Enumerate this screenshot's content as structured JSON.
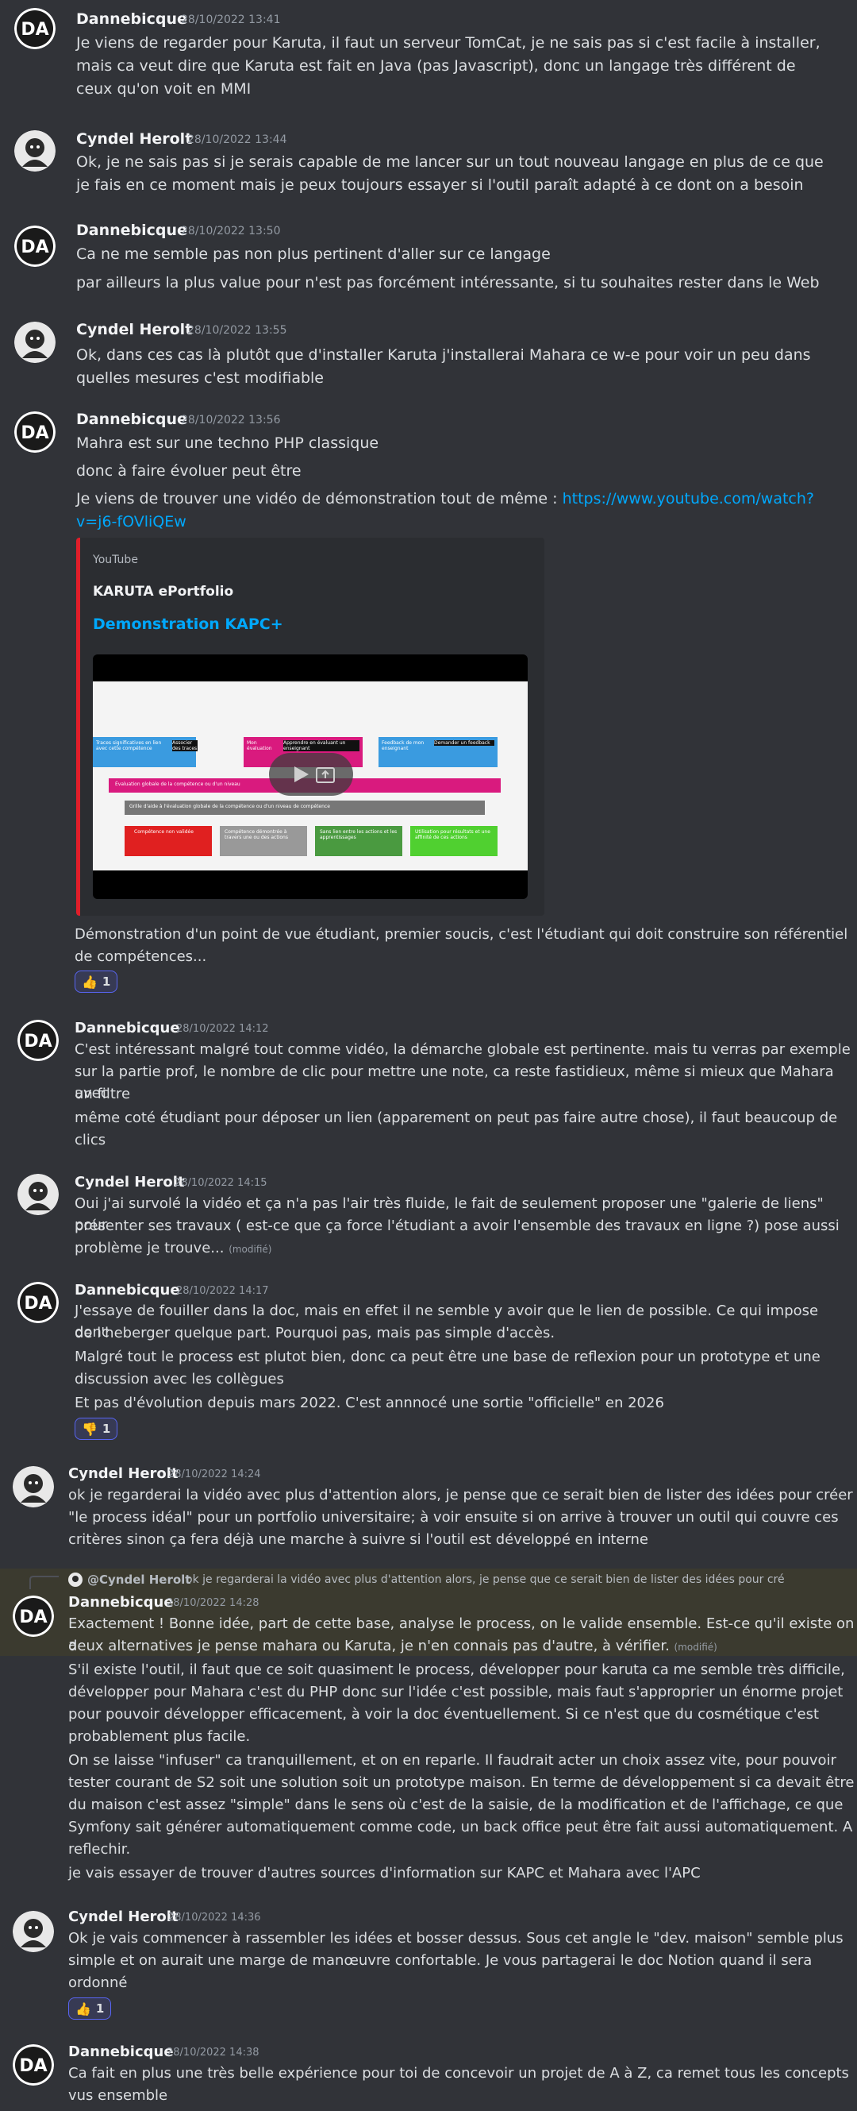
{
  "messages": [
    {
      "author": "Dannebicque",
      "time": "28/10/2022 13:41",
      "lines": [
        "Je viens de regarder pour Karuta, il faut un serveur TomCat, je ne sais pas si c'est facile à installer,",
        "mais ca veut dire que Karuta est fait en Java (pas Javascript), donc un langage très différent de",
        "ceux qu'on voit en MMI"
      ]
    },
    {
      "author": "Cyndel Herolt",
      "time": "28/10/2022 13:44",
      "lines": [
        "Ok, je ne sais pas si je serais capable de me lancer sur un tout nouveau langage en plus de ce que",
        "je fais en ce moment mais je peux toujours essayer si l'outil paraît adapté à ce dont on a besoin"
      ]
    },
    {
      "author": "Dannebicque",
      "time": "28/10/2022 13:50",
      "lines": [
        "Ca ne me semble pas non plus pertinent d'aller sur ce langage",
        "par ailleurs la plus value pour n'est pas forcément intéressante, si tu souhaites rester dans le Web"
      ]
    },
    {
      "author": "Cyndel Herolt",
      "time": "28/10/2022 13:55",
      "lines": [
        "Ok, dans ces cas là plutôt que d'installer Karuta j'installerai Mahara ce w-e pour voir un peu dans",
        "quelles mesures c'est modifiable"
      ]
    },
    {
      "author": "Dannebicque",
      "time": "28/10/2022 13:56",
      "lines": [
        "Mahra est sur une techno PHP classique",
        "donc à faire évoluer peut être",
        "Je viens de trouver une vidéo de démonstration tout de même : "
      ],
      "link": "https://www.youtube.com/watch?v=j6-fOVliQEw",
      "link_line1": "https://www.youtube.com/watch?",
      "link_line2": "v=j6-fOVliQEw"
    },
    {
      "author": "Dannebicque",
      "time": "28/10/2022 14:12",
      "lines": [
        "C'est intéressant malgré tout comme vidéo, la démarche globale est pertinente. mais tu verras par exemple",
        "sur la partie prof, le nombre de clic pour mettre une note, ca reste fastidieux, même si mieux que Mahara avec",
        "un filtre",
        "même coté étudiant pour déposer un lien (apparement on peut pas faire autre chose), il faut beaucoup de",
        "clics"
      ]
    },
    {
      "author": "Cyndel Herolt",
      "time": "28/10/2022 14:15",
      "lines": [
        "Oui j'ai survolé la vidéo et ça n'a pas l'air très fluide, le fait de seulement proposer une \"galerie de liens\" pour",
        "présenter ses travaux ( est-ce que ça force l'étudiant a avoir l'ensemble des travaux en ligne ?) pose aussi",
        "problème je trouve..."
      ]
    },
    {
      "author": "Dannebicque",
      "time": "28/10/2022 14:17",
      "lines": [
        "J'essaye de fouiller dans la doc, mais en effet il ne semble y avoir que le lien de possible. Ce qui impose donc",
        "de l'heberger quelque part. Pourquoi pas, mais pas simple d'accès.",
        "Malgré tout le process est plutot bien, donc ca peut être une base de reflexion pour un prototype et une",
        "discussion avec les collègues",
        "Et pas d'évolution depuis mars 2022. C'est annnocé une sortie \"officielle\" en 2026"
      ]
    },
    {
      "author": "Cyndel Herolt",
      "time": "28/10/2022 14:24",
      "lines": [
        "ok je regarderai la vidéo avec plus d'attention alors, je pense que ce serait bien de lister des idées pour créer",
        "\"le process idéal\" pour un portfolio universitaire; à voir ensuite si on arrive à trouver un outil qui couvre ces",
        "critères sinon ça fera déjà une marche à suivre si l'outil est développé en interne"
      ]
    },
    {
      "author": "Dannebicque",
      "time": "28/10/2022 14:28",
      "reply_name": "@Cyndel Herolt",
      "reply_text": "ok je regarderai la vidéo avec plus d'attention alors, je pense que ce serait bien de lister des idées pour cré",
      "lines": [
        "Exactement ! Bonne idée, part de cette base, analyse le process, on le valide ensemble. Est-ce qu'il existe on a",
        "deux alternatives je pense mahara ou Karuta, je n'en connais pas d'autre, à vérifier.",
        "S'il existe l'outil, il faut que ce soit quasiment le process, développer pour karuta ca me semble très difficile,",
        "développer pour Mahara c'est du PHP donc sur l'idée c'est possible, mais faut s'approprier un énorme projet",
        "pour pouvoir développer efficacement, à voir la doc éventuellement. Si ce n'est que du cosmétique c'est",
        "probablement plus facile.",
        "On se laisse \"infuser\" ca tranquillement, et on en reparle. Il faudrait acter un choix assez vite, pour pouvoir",
        "tester courant de S2 soit une solution soit un prototype maison. En terme de développement si ca devait être",
        "du maison c'est assez \"simple\" dans le sens où c'est de la saisie, de la modification et de l'affichage, ce que",
        "Symfony sait générer automatiquement comme code, un back office peut être fait aussi automatiquement. A",
        "reflechir.",
        "je vais essayer de trouver d'autres sources d'information sur KAPC et Mahara avec l'APC"
      ]
    },
    {
      "author": "Cyndel Herolt",
      "time": "28/10/2022 14:36",
      "lines": [
        "Ok je vais commencer à rassembler les idées et bosser dessus. Sous cet angle le \"dev. maison\" semble plus",
        "simple et on aurait une marge de manœuvre confortable. Je vous partagerai le doc Notion quand il sera",
        "ordonné"
      ]
    },
    {
      "author": "Dannebicque",
      "time": "28/10/2022 14:38",
      "lines": [
        "Ca fait en plus une très belle expérience pour toi de concevoir un projet de A à Z, ca remet tous les concepts",
        "vus ensemble"
      ]
    }
  ],
  "embed": {
    "provider": "YouTube",
    "author": "KARUTA ePortfolio",
    "title": "Demonstration KAPC+",
    "video_labels": [
      "Traces significatives en lien avec cette compétence",
      "Associer des traces",
      "Mon évaluation",
      "Apprendre en évaluant un enseignant",
      "Feedback de mon enseignant",
      "Demander un feedback",
      "Évaluation globale de la compétence ou d'un niveau",
      "Grille d'aide à l'évaluation globale de la compétence ou d'un niveau de compétence",
      "Compétence non validée",
      "Compétence démontrée à travers une ou des actions",
      "Sans lien entre les actions et les apprentissages",
      "Utilisation pour résultats et une affinité de ces actions"
    ]
  },
  "attachment_text": [
    "Démonstration d'un point de vue étudiant, premier soucis, c'est l'étudiant qui doit construire son référentiel",
    "de compétences..."
  ],
  "reactions": {
    "r1": {
      "emoji": "👍",
      "count": "1"
    },
    "r2": {
      "emoji": "👎",
      "count": "1"
    },
    "r3": {
      "emoji": "👍",
      "count": "1"
    }
  },
  "edited_label": "(modifié)",
  "colors": {
    "bg": "#313338",
    "link": "#00a8fc",
    "embed_border": "#e01e2a",
    "embed_title": "#00a8fc",
    "highlight": "#3b3a2f"
  }
}
